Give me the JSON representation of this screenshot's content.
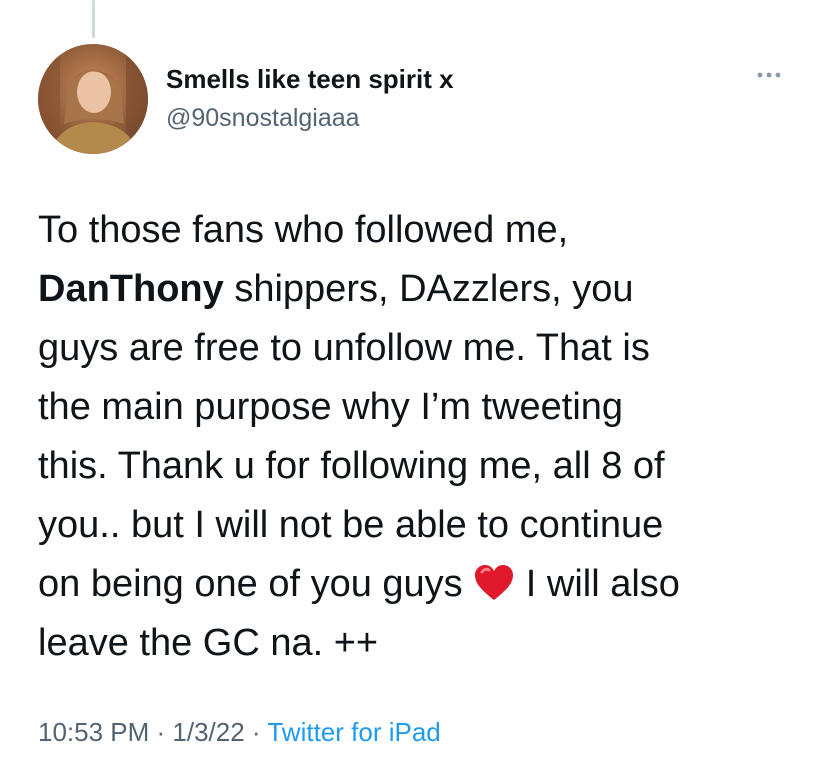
{
  "tweet": {
    "author": {
      "display_name": "Smells like teen spirit x",
      "handle": "@90snostalgiaaa",
      "avatar": "avatar-icon"
    },
    "more_icon": "more-horizontal-icon",
    "text": {
      "line1": "To those fans who followed me,",
      "bold_mention": "DanThony",
      "line2_rest": " shippers, DAzzlers, you",
      "line3": "guys are free to unfollow me. That is",
      "line4": "the main purpose why I’m tweeting",
      "line5": "this. Thank u for following me, all 8 of",
      "line6": "you.. but I will not be able to continue",
      "line7_before_emoji": "on being one of you guys ",
      "emoji": "red-heart-icon",
      "line7_after_emoji": " I will also",
      "line8": "leave the GC na. ++"
    },
    "meta": {
      "time": "10:53 PM",
      "separator1": " · ",
      "date": "1/3/22",
      "separator2": " · ",
      "source": "Twitter for iPad"
    }
  },
  "colors": {
    "text_primary": "#0f1419",
    "text_secondary": "#536471",
    "link": "#1d9bf0",
    "heart": "#e0182c",
    "thread_line": "#cfd9de"
  }
}
